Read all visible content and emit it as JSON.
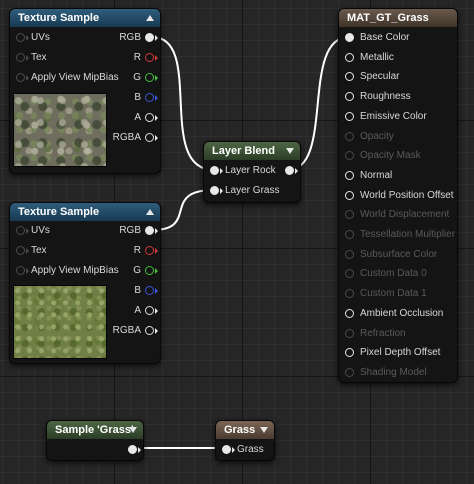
{
  "texture_sample_1": {
    "title": "Texture Sample",
    "inputs": [
      "UVs",
      "Tex",
      "Apply View MipBias"
    ],
    "outputs": [
      "RGB",
      "R",
      "G",
      "B",
      "A",
      "RGBA"
    ]
  },
  "texture_sample_2": {
    "title": "Texture Sample",
    "inputs": [
      "UVs",
      "Tex",
      "Apply View MipBias"
    ],
    "outputs": [
      "RGB",
      "R",
      "G",
      "B",
      "A",
      "RGBA"
    ]
  },
  "layer_blend": {
    "title": "Layer Blend",
    "inputs": [
      "Layer Rock",
      "Layer Grass"
    ]
  },
  "material": {
    "title": "MAT_GT_Grass",
    "pins": [
      {
        "label": "Base Color",
        "enabled": true
      },
      {
        "label": "Metallic",
        "enabled": true
      },
      {
        "label": "Specular",
        "enabled": true
      },
      {
        "label": "Roughness",
        "enabled": true
      },
      {
        "label": "Emissive Color",
        "enabled": true
      },
      {
        "label": "Opacity",
        "enabled": false
      },
      {
        "label": "Opacity Mask",
        "enabled": false
      },
      {
        "label": "Normal",
        "enabled": true
      },
      {
        "label": "World Position Offset",
        "enabled": true
      },
      {
        "label": "World Displacement",
        "enabled": false
      },
      {
        "label": "Tessellation Multiplier",
        "enabled": false
      },
      {
        "label": "Subsurface Color",
        "enabled": false
      },
      {
        "label": "Custom Data 0",
        "enabled": false
      },
      {
        "label": "Custom Data 1",
        "enabled": false
      },
      {
        "label": "Ambient Occlusion",
        "enabled": true
      },
      {
        "label": "Refraction",
        "enabled": false
      },
      {
        "label": "Pixel Depth Offset",
        "enabled": true
      },
      {
        "label": "Shading Model",
        "enabled": false
      }
    ]
  },
  "sample_grass": {
    "title": "Sample 'Grass'"
  },
  "grass_node": {
    "title": "Grass",
    "input": "Grass"
  },
  "colors": {
    "texture_header": "#2f5d7c",
    "layer_header": "#4d6644",
    "material_header": "#6b5a4c",
    "grass_header": "#7b6656",
    "wire": "#ffffff",
    "pin_r": "#d23a3a",
    "pin_g": "#45c13d",
    "pin_b": "#3a55d6"
  }
}
